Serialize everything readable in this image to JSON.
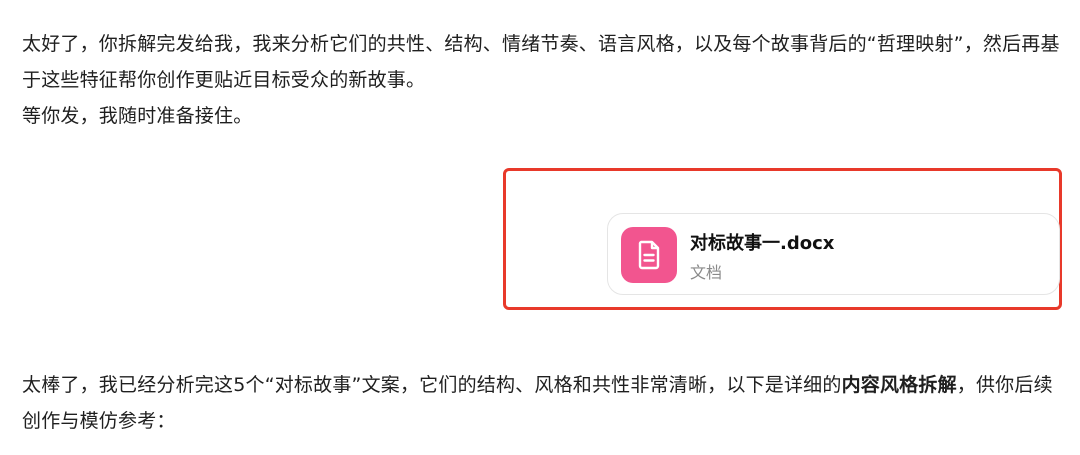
{
  "messages": {
    "first": {
      "line1": "太好了，你拆解完发给我，我来分析它们的共性、结构、情绪节奏、语言风格，以及每个故事背后的“哲理映射”，然后再基于这些特征帮你创作更贴近目标受众的新故事。",
      "line2": "等你发，我随时准备接住。"
    },
    "second": {
      "text_before": "太棒了，我已经分析完这5个“对标故事”文案，它们的结构、风格和共性非常清晰，以下是详细的",
      "text_bold": "内容风格拆解",
      "text_after": "，供你后续创作与模仿参考："
    }
  },
  "attachment": {
    "filename": "对标故事一.docx",
    "filetype": "文档",
    "icon": "document-icon",
    "icon_color": "#f2558f",
    "highlight_color": "#e8392a"
  }
}
